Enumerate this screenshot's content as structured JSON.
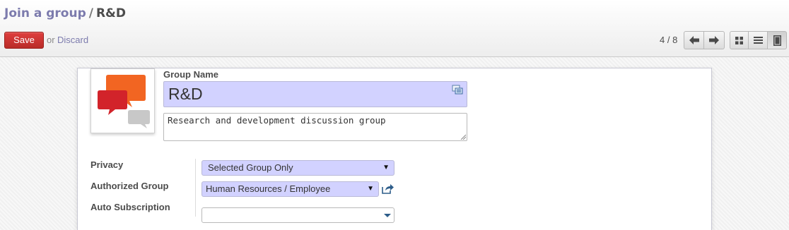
{
  "breadcrumb": {
    "parent": "Join a group",
    "separator": "/",
    "current": "R&D"
  },
  "toolbar": {
    "save_label": "Save",
    "or_label": "or",
    "discard_label": "Discard"
  },
  "pager": {
    "value": "4 / 8",
    "prev_icon": "arrow-left-icon",
    "next_icon": "arrow-right-icon"
  },
  "view_switcher": {
    "views": [
      "kanban-view-icon",
      "list-view-icon",
      "form-view-icon"
    ],
    "active": "form"
  },
  "form": {
    "avatar_icon": "chat-bubbles-icon",
    "group_name_label": "Group Name",
    "group_name_value": "R&D",
    "description_value": "Research and development discussion group",
    "privacy_label": "Privacy",
    "privacy_value": "Selected Group Only",
    "authorized_group_label": "Authorized Group",
    "authorized_group_value": "Human Resources / Employee",
    "auto_subscription_label": "Auto Subscription",
    "auto_subscription_value": ""
  },
  "colors": {
    "brand_link": "#7c7bad",
    "save_button": "#c9302c",
    "required_field_bg": "#d2d2ff",
    "avatar_orange": "#f26522",
    "avatar_red": "#d2232a",
    "avatar_grey": "#c8c8c8"
  }
}
